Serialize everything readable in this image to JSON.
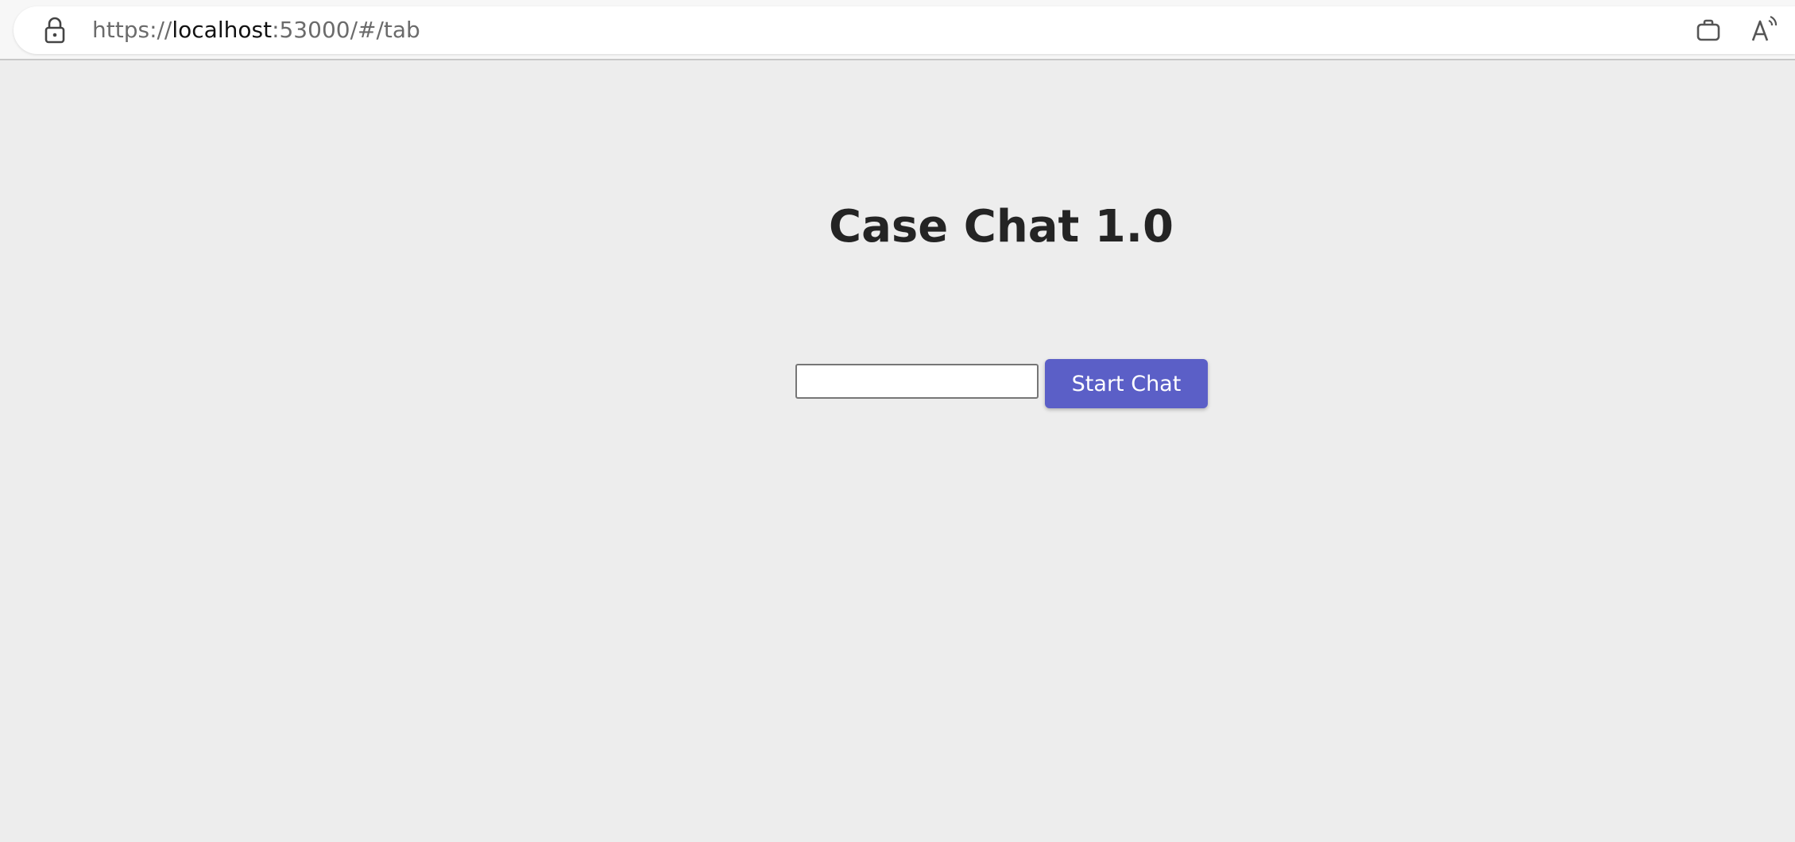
{
  "browser": {
    "url_scheme": "https://",
    "url_host": "localhost",
    "url_rest": ":53000/#/tab",
    "icons": {
      "lock": "lock-icon",
      "workspaces": "briefcase-icon",
      "read_aloud": "read-aloud-icon"
    }
  },
  "page": {
    "title": "Case Chat 1.0",
    "input_value": "",
    "start_button_label": "Start Chat",
    "colors": {
      "background": "#ededed",
      "button": "#5b5fc7",
      "button_text": "#ffffff",
      "title": "#242424"
    }
  }
}
